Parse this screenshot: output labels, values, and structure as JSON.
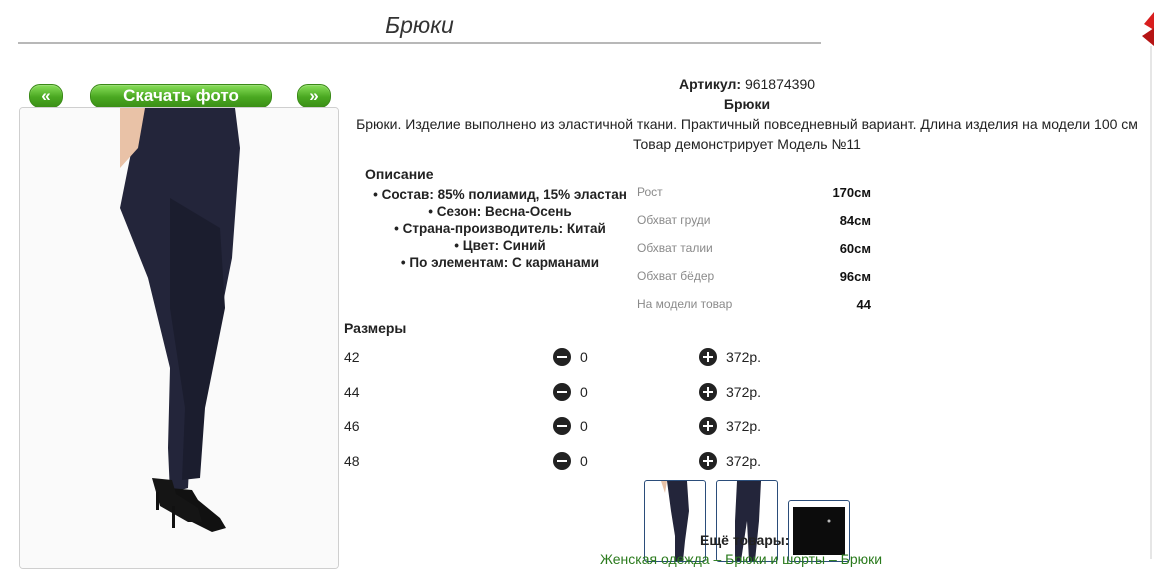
{
  "page": {
    "title": "Брюки"
  },
  "nav": {
    "prev_label": "«",
    "download_label": "Скачать фото",
    "next_label": "»"
  },
  "product": {
    "article_label": "Артикул:",
    "article_value": "961874390",
    "name": "Брюки",
    "summary": "Брюки. Изделие выполнено из эластичной ткани. Практичный повседневный вариант. Длина изделия на модели 100 см",
    "model_note": "Товар демонстрирует Модель №11"
  },
  "description": {
    "heading": "Описание",
    "items": [
      "Состав: 85% полиамид, 15% эластан",
      "Сезон: Весна-Осень",
      "Страна-производитель: Китай",
      "Цвет: Синий",
      "По элементам: С карманами"
    ]
  },
  "measurements": [
    {
      "label": "Рост",
      "value": "170см"
    },
    {
      "label": "Обхват груди",
      "value": "84см"
    },
    {
      "label": "Обхват талии",
      "value": "60см"
    },
    {
      "label": "Обхват бёдер",
      "value": "96см"
    },
    {
      "label": "На модели товар",
      "value": "44"
    }
  ],
  "sizes": {
    "heading": "Размеры",
    "rows": [
      {
        "size": "42",
        "qty": "0",
        "price": "372р."
      },
      {
        "size": "44",
        "qty": "0",
        "price": "372р."
      },
      {
        "size": "46",
        "qty": "0",
        "price": "372р."
      },
      {
        "size": "48",
        "qty": "0",
        "price": "372р."
      }
    ]
  },
  "more": {
    "heading": "Ещё товары:",
    "links": "Женская одежда – Брюки и шорты – Брюки"
  },
  "colors": {
    "button_green": "#4aa821",
    "link_green": "#2a7a1c",
    "pants_navy": "#23253a",
    "accent_red": "#d81e1e"
  }
}
